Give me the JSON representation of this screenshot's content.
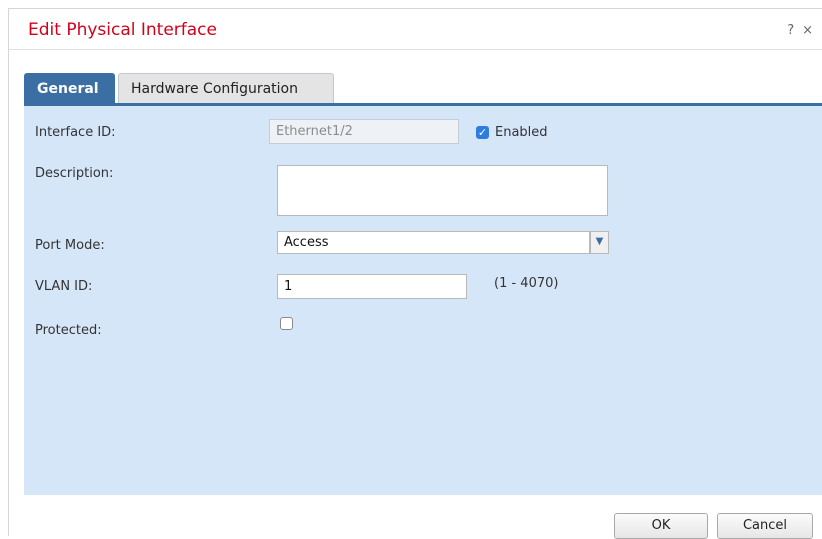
{
  "dialog": {
    "title": "Edit Physical Interface",
    "help_icon": "?",
    "close_icon": "×"
  },
  "tabs": [
    {
      "label": "General",
      "active": true
    },
    {
      "label": "Hardware Configuration",
      "active": false
    }
  ],
  "form": {
    "interface_id": {
      "label": "Interface ID:",
      "value": "Ethernet1/2",
      "enabled_label": "Enabled",
      "enabled_checked": true
    },
    "description": {
      "label": "Description:",
      "value": ""
    },
    "port_mode": {
      "label": "Port Mode:",
      "value": "Access"
    },
    "vlan_id": {
      "label": "VLAN ID:",
      "value": "1",
      "range_hint": "(1 - 4070)"
    },
    "protected": {
      "label": "Protected:",
      "checked": false
    }
  },
  "footer": {
    "ok_label": "OK",
    "cancel_label": "Cancel"
  },
  "colors": {
    "title": "#d0021b",
    "tab_active": "#3b6fa3",
    "panel_bg": "#d6e6f9",
    "checkbox_checked": "#2f7ce0"
  }
}
